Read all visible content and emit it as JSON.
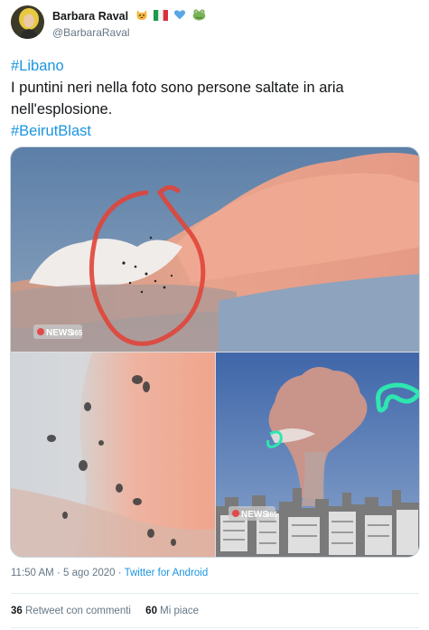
{
  "user": {
    "display_name": "Barbara Raval",
    "handle": "@BarbaraRaval",
    "emojis": [
      "cat-face-emoji",
      "italy-flag-emoji",
      "blue-heart-emoji",
      "frog-emoji"
    ]
  },
  "tweet": {
    "lines": [
      {
        "parts": [
          {
            "text": "#Libano",
            "hashtag": true
          }
        ]
      },
      {
        "parts": [
          {
            "text": "I puntini neri nella foto sono persone saltate in aria",
            "hashtag": false
          }
        ]
      },
      {
        "parts": [
          {
            "text": "nell'esplosione.",
            "hashtag": false
          }
        ]
      },
      {
        "parts": [
          {
            "text": "#BeirutBlast",
            "hashtag": true
          }
        ]
      }
    ]
  },
  "media": {
    "photo_watermark": "NEWS365",
    "photo_watermark_small": "NEWS",
    "photo_watermark_small_num": "365",
    "annotation_colors": {
      "red": "#e0453a",
      "green": "#2ee6b0"
    }
  },
  "meta": {
    "time": "11:50 AM",
    "separator": " · ",
    "date": "5 ago 2020",
    "source": "Twitter for Android"
  },
  "stats": {
    "retweets_count": "36",
    "retweets_label": "Retweet con commenti",
    "likes_count": "60",
    "likes_label": "Mi piace"
  }
}
